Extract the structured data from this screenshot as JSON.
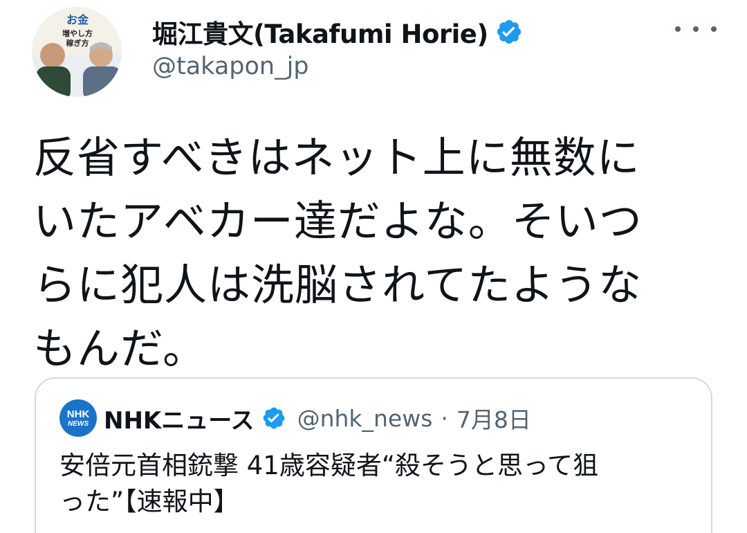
{
  "author": {
    "display_name": "堀江貴文(Takafumi Horie)",
    "handle": "@takapon_jp",
    "avatar_text": [
      "お金",
      "増やし方",
      "稼ぎ方"
    ]
  },
  "tweet": {
    "text": "反省すべきはネット上に無数に\nいたアベカー達だよな。そいつ\nらに犯人は洗脳されてたような\nもんだ。"
  },
  "quoted_tweet": {
    "logo_text_top": "NHK",
    "logo_text_bottom": "NEWS",
    "display_name": "NHKニュース",
    "handle": "@nhk_news",
    "separator": "·",
    "date": "7月8日",
    "text": "安倍元首相銃撃 41歳容疑者“殺そうと思って狙\nった”【速報中】"
  },
  "colors": {
    "verified_blue": "#1d9bf0",
    "secondary_text": "#536471",
    "card_border": "#cfd9de",
    "nhk_blue": "#1a73c8"
  },
  "icons": [
    "verified-badge-icon",
    "more-options-icon",
    "nhk-logo-icon"
  ]
}
